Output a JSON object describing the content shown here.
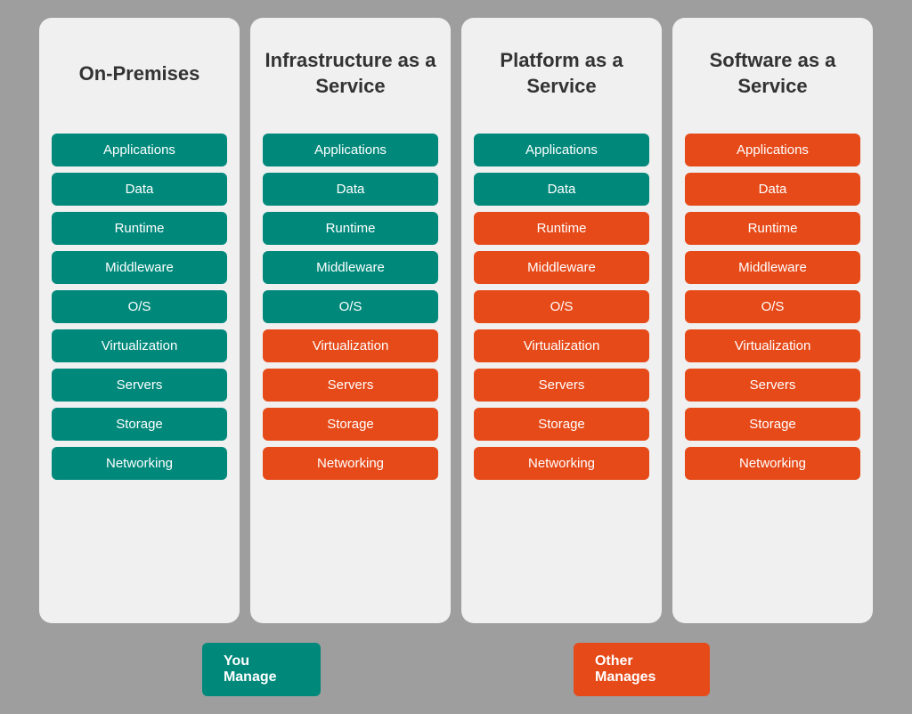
{
  "columns": [
    {
      "id": "on-premises",
      "title": "On-Premises",
      "items": [
        {
          "label": "Applications",
          "color": "teal"
        },
        {
          "label": "Data",
          "color": "teal"
        },
        {
          "label": "Runtime",
          "color": "teal"
        },
        {
          "label": "Middleware",
          "color": "teal"
        },
        {
          "label": "O/S",
          "color": "teal"
        },
        {
          "label": "Virtualization",
          "color": "teal"
        },
        {
          "label": "Servers",
          "color": "teal"
        },
        {
          "label": "Storage",
          "color": "teal"
        },
        {
          "label": "Networking",
          "color": "teal"
        }
      ]
    },
    {
      "id": "iaas",
      "title": "Infrastructure as a Service",
      "items": [
        {
          "label": "Applications",
          "color": "teal"
        },
        {
          "label": "Data",
          "color": "teal"
        },
        {
          "label": "Runtime",
          "color": "teal"
        },
        {
          "label": "Middleware",
          "color": "teal"
        },
        {
          "label": "O/S",
          "color": "teal"
        },
        {
          "label": "Virtualization",
          "color": "orange"
        },
        {
          "label": "Servers",
          "color": "orange"
        },
        {
          "label": "Storage",
          "color": "orange"
        },
        {
          "label": "Networking",
          "color": "orange"
        }
      ]
    },
    {
      "id": "paas",
      "title": "Platform as a Service",
      "items": [
        {
          "label": "Applications",
          "color": "teal"
        },
        {
          "label": "Data",
          "color": "teal"
        },
        {
          "label": "Runtime",
          "color": "orange"
        },
        {
          "label": "Middleware",
          "color": "orange"
        },
        {
          "label": "O/S",
          "color": "orange"
        },
        {
          "label": "Virtualization",
          "color": "orange"
        },
        {
          "label": "Servers",
          "color": "orange"
        },
        {
          "label": "Storage",
          "color": "orange"
        },
        {
          "label": "Networking",
          "color": "orange"
        }
      ]
    },
    {
      "id": "saas",
      "title": "Software as a Service",
      "items": [
        {
          "label": "Applications",
          "color": "orange"
        },
        {
          "label": "Data",
          "color": "orange"
        },
        {
          "label": "Runtime",
          "color": "orange"
        },
        {
          "label": "Middleware",
          "color": "orange"
        },
        {
          "label": "O/S",
          "color": "orange"
        },
        {
          "label": "Virtualization",
          "color": "orange"
        },
        {
          "label": "Servers",
          "color": "orange"
        },
        {
          "label": "Storage",
          "color": "orange"
        },
        {
          "label": "Networking",
          "color": "orange"
        }
      ]
    }
  ],
  "legend": {
    "you_manage": "You Manage",
    "other_manages": "Other Manages"
  }
}
